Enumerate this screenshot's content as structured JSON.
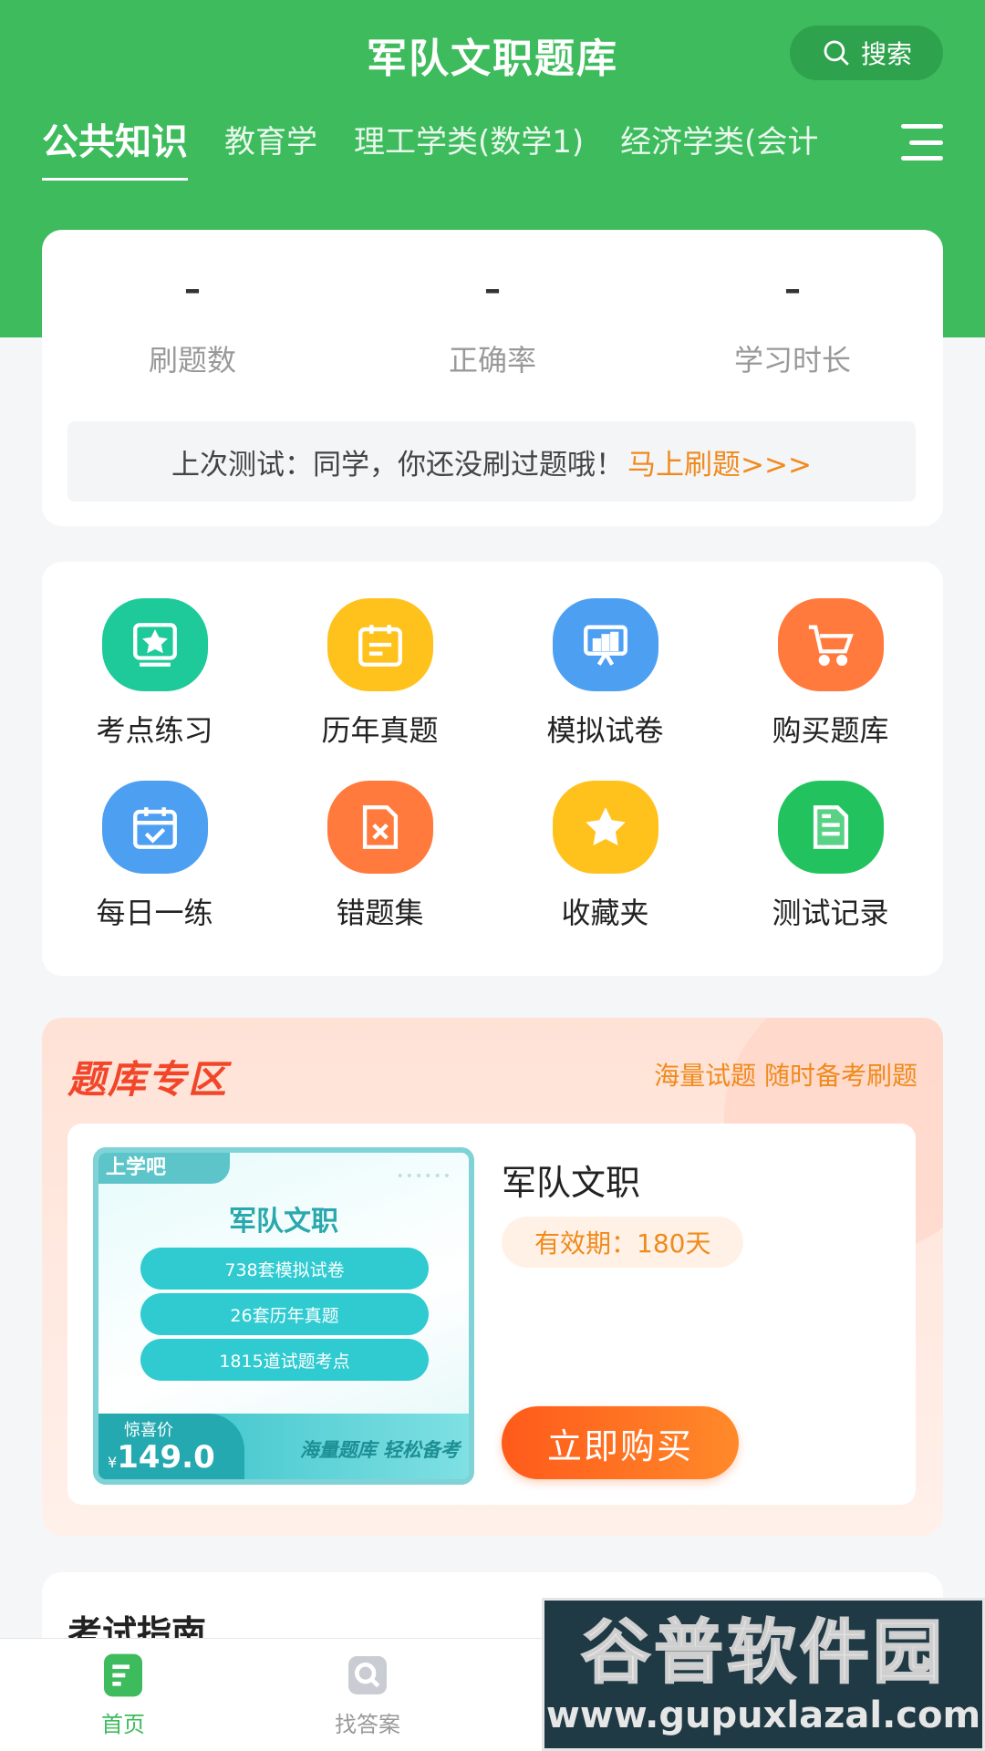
{
  "header": {
    "title": "军队文职题库",
    "search_label": "搜索",
    "tabs": [
      "公共知识",
      "教育学",
      "理工学类(数学1)",
      "经济学类(会计"
    ]
  },
  "stats": {
    "items": [
      {
        "value": "–",
        "label": "刷题数"
      },
      {
        "value": "–",
        "label": "正确率"
      },
      {
        "value": "–",
        "label": "学习时长"
      }
    ],
    "last_test_text": "上次测试：同学，你还没刷过题哦！",
    "last_test_link": "马上刷题>>>"
  },
  "features": [
    {
      "label": "考点练习",
      "icon": "exam-point-icon",
      "color": "#1ec99a"
    },
    {
      "label": "历年真题",
      "icon": "calendar-icon",
      "color": "#ffc21c"
    },
    {
      "label": "模拟试卷",
      "icon": "presentation-icon",
      "color": "#4d9ff2"
    },
    {
      "label": "购买题库",
      "icon": "cart-icon",
      "color": "#ff7a3c"
    },
    {
      "label": "每日一练",
      "icon": "calendar-check-icon",
      "color": "#4d9ff2"
    },
    {
      "label": "错题集",
      "icon": "wrong-file-icon",
      "color": "#ff7a3c"
    },
    {
      "label": "收藏夹",
      "icon": "star-icon",
      "color": "#ffc21c"
    },
    {
      "label": "测试记录",
      "icon": "document-icon",
      "color": "#22c35e"
    }
  ],
  "promo": {
    "title": "题库专区",
    "subtitle": "海量试题  随时备考刷题",
    "cover": {
      "badge": "上学吧",
      "title": "军队文职",
      "pills": [
        "738套模拟试卷",
        "26套历年真题",
        "1815道试题考点"
      ],
      "price_label": "惊喜价",
      "currency": "¥",
      "price": "149.0",
      "slogan": "海量题库  轻松备考"
    },
    "product_name": "军队文职",
    "validity": "有效期：180天",
    "buy_label": "立即购买"
  },
  "guide": {
    "title": "考试指南"
  },
  "bottom_nav": [
    {
      "label": "首页",
      "icon": "home-icon",
      "active": true
    },
    {
      "label": "找答案",
      "icon": "find-answer-icon",
      "active": false
    }
  ],
  "watermark": {
    "text": "谷普软件园",
    "url": "www.gupuxlazal.com"
  },
  "colors": {
    "brand_green": "#3dbb5d",
    "accent_orange": "#f08a1c",
    "buy_red": "#ff5a1a"
  }
}
